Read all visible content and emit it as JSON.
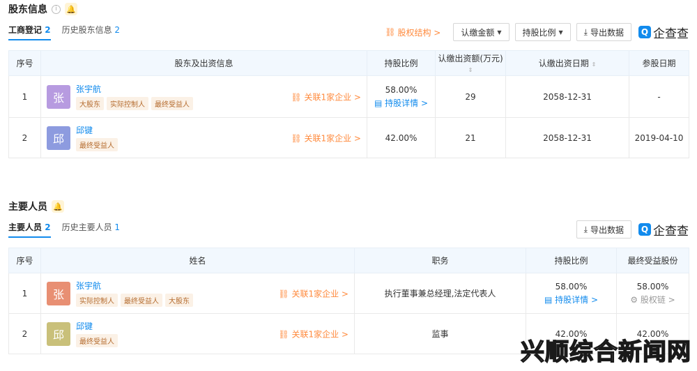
{
  "shareholders": {
    "title": "股东信息",
    "tabs": [
      {
        "label": "工商登记",
        "count": "2"
      },
      {
        "label": "历史股东信息",
        "count": "2"
      }
    ],
    "equity_link": "股权结构 >",
    "filter_amount": "认缴金额",
    "filter_ratio": "持股比例",
    "export": "导出数据",
    "logo_text": "企查查",
    "headers": [
      "序号",
      "股东及出资信息",
      "持股比例",
      "认缴出资额(万元)",
      "认缴出资日期",
      "参股日期"
    ],
    "rows": [
      {
        "no": "1",
        "avatar": "张",
        "avatar_color": "#b79be0",
        "name": "张宇航",
        "tags": [
          "大股东",
          "实际控制人",
          "最终受益人"
        ],
        "related": "关联1家企业 >",
        "ratio": "58.00%",
        "ratio_link": "持股详情 >",
        "amount": "29",
        "date": "2058-12-31",
        "join": "-"
      },
      {
        "no": "2",
        "avatar": "邱",
        "avatar_color": "#8d9bdf",
        "name": "邱键",
        "tags": [
          "最终受益人"
        ],
        "related": "关联1家企业 >",
        "ratio": "42.00%",
        "ratio_link": "",
        "amount": "21",
        "date": "2058-12-31",
        "join": "2019-04-10"
      }
    ]
  },
  "personnel": {
    "title": "主要人员",
    "tabs": [
      {
        "label": "主要人员",
        "count": "2"
      },
      {
        "label": "历史主要人员",
        "count": "1"
      }
    ],
    "export": "导出数据",
    "logo_text": "企查查",
    "headers": [
      "序号",
      "姓名",
      "职务",
      "持股比例",
      "最终受益股份"
    ],
    "rows": [
      {
        "no": "1",
        "avatar": "张",
        "avatar_color": "#e88f73",
        "name": "张宇航",
        "tags": [
          "实际控制人",
          "最终受益人",
          "大股东"
        ],
        "related": "关联1家企业 >",
        "position": "执行董事兼总经理,法定代表人",
        "ratio": "58.00%",
        "ratio_link": "持股详情 >",
        "benefit": "58.00%",
        "benefit_link": "股权链 >"
      },
      {
        "no": "2",
        "avatar": "邱",
        "avatar_color": "#c9c07a",
        "name": "邱键",
        "tags": [
          "最终受益人"
        ],
        "related": "关联1家企业 >",
        "position": "监事",
        "ratio": "42.00%",
        "ratio_link": "",
        "benefit": "42.00%",
        "benefit_link": ""
      }
    ]
  },
  "watermark": "兴顺综合新闻网"
}
